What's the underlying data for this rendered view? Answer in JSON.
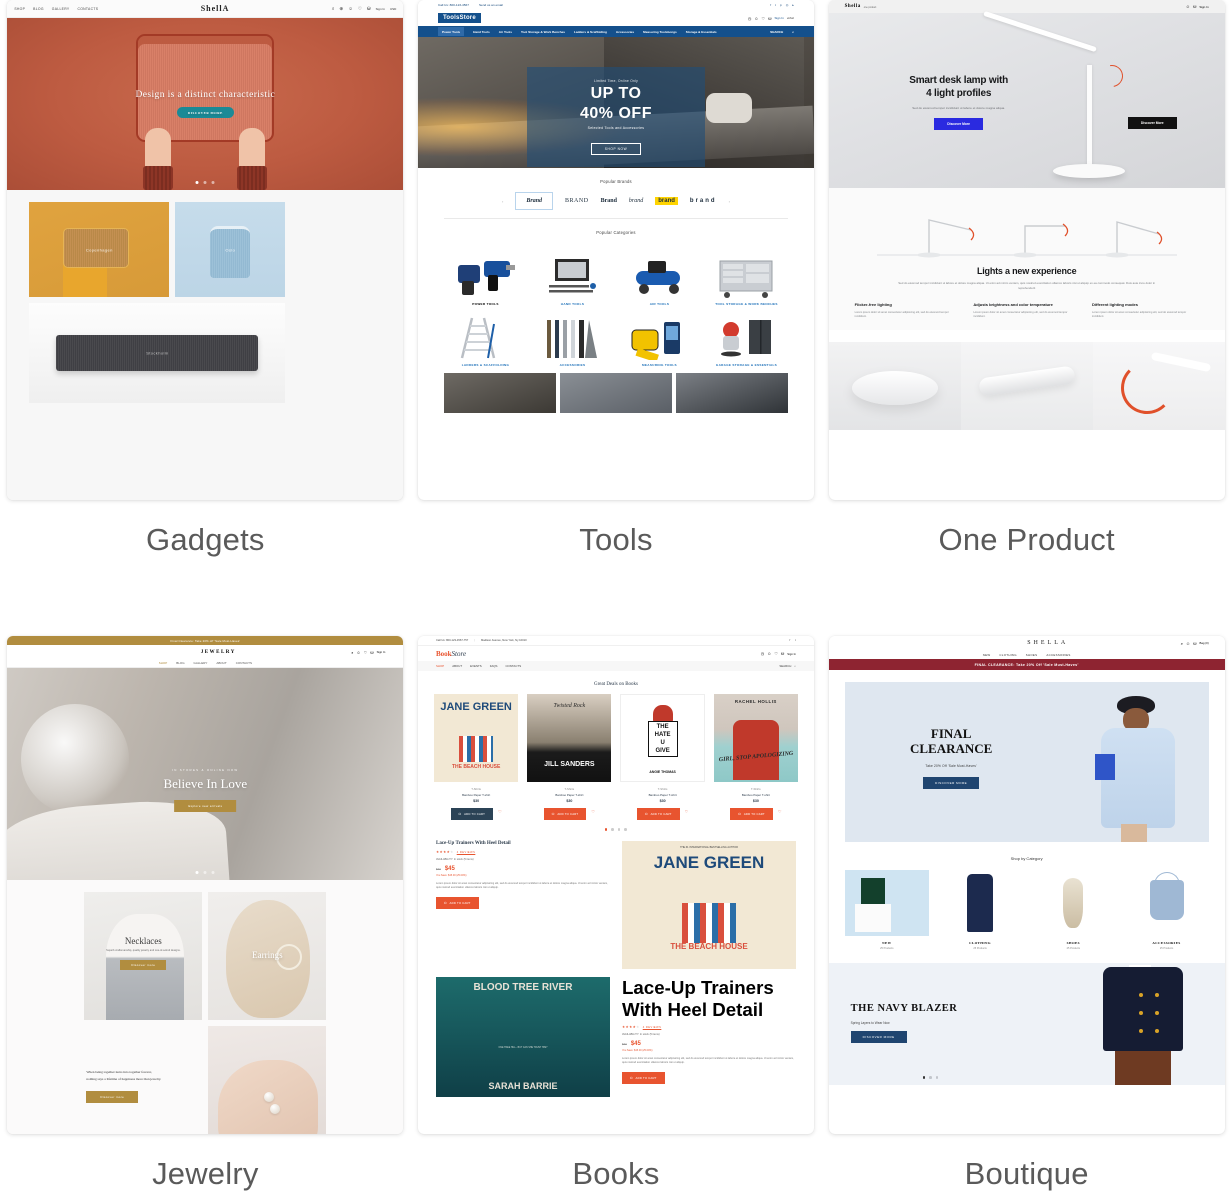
{
  "gallery": {
    "cells": [
      {
        "caption": "Gadgets",
        "site": {
          "logo": "ShellA",
          "nav": [
            "SHOP",
            "BLOG",
            "GALLERY",
            "CONTACTS"
          ],
          "account": "Sign In",
          "lang": "USD",
          "hero_title": "Design is a distinct characteristic",
          "hero_button": "DISCOVER MORE",
          "products": [
            "Copenhagen",
            "Oslo",
            "Stockholm"
          ]
        }
      },
      {
        "caption": "Tools",
        "site": {
          "logo": "ToolsStore",
          "phone": "Call Us: 800-123-4567",
          "email": "Send us an email",
          "account": "Sign In",
          "lang": "eMail",
          "nav": [
            "Power Tools",
            "Hand Tools",
            "Air Tools",
            "Tool Storage & Work Benches",
            "Ladders & Scaffolding",
            "Accessories",
            "Measuring Toolsbongs",
            "Storage & Essentials"
          ],
          "search": "SEARCH",
          "promo_kicker": "Limited Time, Online Only",
          "promo_big_1": "UP TO",
          "promo_big_2": "40% OFF",
          "promo_sub": "Selected Tools and Accessories",
          "promo_button": "SHOP NOW",
          "brands_title": "Popular Brands",
          "brands": [
            "Brand",
            "BRAND",
            "Brand",
            "brand",
            "brand",
            "brand"
          ],
          "categories_title": "Popular Categories",
          "categories": [
            "POWER TOOLS",
            "HAND TOOLS",
            "AIR TOOLS",
            "TOOL STORAGE & WORK BENCHES",
            "LADDERS & SCAFFOLDING",
            "ACCESSORIES",
            "MEASURING TOOLS",
            "GARAGE STORAGE & ESSENTIALS"
          ]
        }
      },
      {
        "caption": "One Product",
        "site": {
          "logo": "Shella",
          "logo_sub": "one product",
          "account": "Sign In",
          "hero_title_1": "Smart desk lamp with",
          "hero_title_2": "4 light profiles",
          "hero_sub": "Sed do eiusmod tempor incididunt ut labore et dolore magna aliqua.",
          "hero_button": "Discover More",
          "hero_button_2": "Discover More",
          "section_title": "Lights a new experience",
          "section_sub": "Sed do eiusmod tempor incididunt ut labore et dolore magna aliqua. Ut enim ad minim veniam, quis nostrud exercitation ullamco laboris nisi ut aliquip ex ea commodo consequat. Duis aute irure dolor in reprehenderit",
          "features": [
            {
              "title": "Flicker-free lighting",
              "text": "Lorem ipsum dolor sit amet consectetur adipisicing elit, sed do eiusmod tempor incididunt."
            },
            {
              "title": "Adjusts brightness and color temperature",
              "text": "Lorem ipsum dolor sit amet consectetur adipisicing elit, sed do eiusmod tempor incididunt."
            },
            {
              "title": "Different lighting modes",
              "text": "Lorem ipsum dolor sit amet consectetur adipisicing elit, sed do eiusmod tempor incididunt."
            }
          ]
        }
      },
      {
        "caption": "Jewelry",
        "site": {
          "banner": "Final Clearance: Take 20% off 'Sale Must-Haves'",
          "logo": "JEWELRY",
          "account": "Sign In",
          "nav": [
            "SHOP",
            "BLOG",
            "GALLERY",
            "ABOUT",
            "CONTACTS"
          ],
          "hero_kicker": "IN STORES & ONLINE NOW",
          "hero_title": "Believe In Love",
          "hero_button": "Explore new arrivals",
          "cat_1_title": "Necklaces",
          "cat_1_text": "Superb craftsmanship, quality jewelry and one-of-a-kind designs.",
          "cat_1_button": "Discover more",
          "cat_2_title": "Earrings",
          "quote_line_1": "When being together turns into together forever,",
          "quote_line_2": "nothing says a lifetime of happiness more than jewelry.",
          "quote_button": "Discover more"
        }
      },
      {
        "caption": "Books",
        "site": {
          "phone": "Call Us: 800-123-4567-757",
          "address": "Madison Avenue, New York, Ny 10010",
          "logo_1": "Book",
          "logo_2": "Store",
          "account": "Sign In",
          "nav": [
            "SHOP",
            "ABOUT",
            "EVENTS",
            "FAQS",
            "CONTACTS"
          ],
          "search": "SEARCH",
          "section_title": "Great Deals on Books",
          "products": [
            {
              "category": "T-Shirts",
              "name": "Bamboo Paper T-shirt",
              "price": "$30",
              "button": "ADD TO CART"
            },
            {
              "category": "T-Shirts",
              "name": "Bamboo Paper T-shirt",
              "price": "$30",
              "button": "ADD TO CART"
            },
            {
              "category": "T-Shirts",
              "name": "Bamboo Paper T-shirt",
              "price": "$30",
              "button": "ADD TO CART"
            },
            {
              "category": "T-Shirts",
              "name": "Bamboo Paper T-shirt",
              "price": "$30",
              "button": "ADD TO CART"
            }
          ],
          "covers": [
            {
              "top": "JANE GREEN",
              "bottom": "THE BEACH HOUSE"
            },
            {
              "top": "Twisted Rock",
              "bottom": "JILL SANDERS"
            },
            {
              "top": "THE HATE U GIVE",
              "bottom": "ANGIE THOMAS"
            },
            {
              "top": "RACHEL HOLLIS",
              "bottom": "GIRL, STOP APOLOGIZING"
            }
          ],
          "detail": {
            "title": "Lace-Up Trainers With Heel Detail",
            "reviews": "4 REVIEWS",
            "availability": "AVAILABILITY: In stock (5 items)",
            "old_price": "$60",
            "new_price": "$45",
            "save": "You Save: $15.00 (25.00%)",
            "text": "Lorem ipsum dolor sit amet consectetur adipisicing elit, sed do eiusmod tempor incididunt ut labore et dolore magna aliqua. Ut enim ad minim veniam, quis nostrud exercitation ullamco laboris nisi ut aliquip.",
            "button": "ADD TO CART"
          },
          "big_cover": {
            "kicker": "THE #1 INTERNATIONAL BESTSELLING AUTHOR",
            "top": "JANE GREEN",
            "bottom": "THE BEACH HOUSE"
          },
          "cover_5": {
            "top": "BLOOD TREE RIVER",
            "bottom": "SARAH BARRIE",
            "mid": "ONE TREE HILL - BUT CAN SHE TRUST HIM?"
          }
        }
      },
      {
        "caption": "Boutique",
        "site": {
          "logo": "SHELLA",
          "account": "Bag (0)",
          "nav": [
            "NEW",
            "CLOTHING",
            "SHOES",
            "ACCESSORIES"
          ],
          "banner": "FINAL CLEARANCE: Take 20% Off 'Sale Must-Haves'",
          "hero_title_1": "FINAL",
          "hero_title_2": "CLEARANCE",
          "hero_sub": "Take 20% Off 'Sale Must-Haves'",
          "hero_button": "DISCOVER MORE",
          "cats_title": "Shop by Category",
          "categories": [
            {
              "name": "NEW",
              "count": "25 Products"
            },
            {
              "name": "CLOTHING",
              "count": "25 Products"
            },
            {
              "name": "SHOES",
              "count": "25 Products"
            },
            {
              "name": "ACCESSORIES",
              "count": "25 Products"
            }
          ],
          "promo_title": "THE NAVY BLAZER",
          "promo_sub": "Spring Layers to Wear Now",
          "promo_button": "DISCOVER MORE"
        }
      }
    ]
  }
}
